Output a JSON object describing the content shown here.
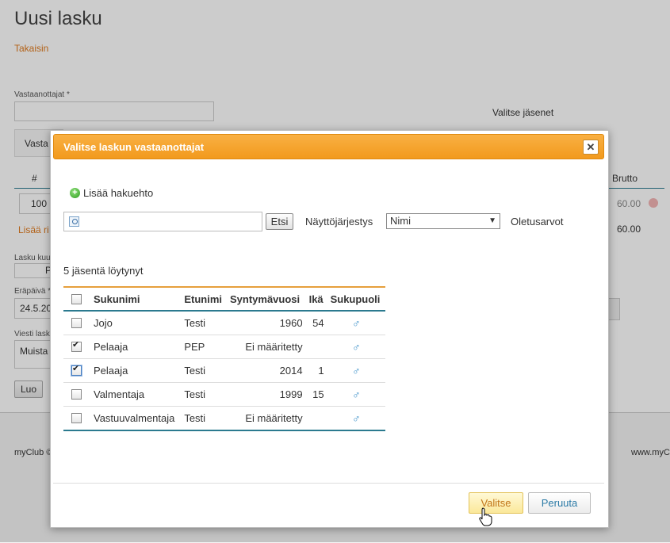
{
  "page": {
    "title": "Uusi lasku",
    "back_link": "Takaisin",
    "recipients_label": "Vastaanottajat *",
    "select_members": "Valitse jäsenet",
    "fragment_vasta": "Vasta",
    "col_hash": "#",
    "col_brutto": "Brutto",
    "qty": "100",
    "amount1": "60.00",
    "add_row": "Lisää ri",
    "amount2": "60.00",
    "invoice_label": "Lasku kuul",
    "p_letter": "P",
    "due_label": "Eräpäivä *",
    "due_value": "24.5.20",
    "message_label": "Viesti lask",
    "message_value": "Muista",
    "create_button": "Luo",
    "footer_left": "myClub ©",
    "footer_right": "www.myC"
  },
  "modal": {
    "title": "Valitse laskun vastaanottajat",
    "close": "✕",
    "add_criteria": "Lisää hakuehto",
    "search_button": "Etsi",
    "sort_label": "Näyttöjärjestys",
    "sort_value": "Nimi",
    "defaults": "Oletusarvot",
    "result_count": "5 jäsentä löytynyt",
    "columns": {
      "surname": "Sukunimi",
      "firstname": "Etunimi",
      "birthyear": "Syntymävuosi",
      "age": "Ikä",
      "gender": "Sukupuoli"
    },
    "rows": [
      {
        "surname": "Jojo",
        "firstname": "Testi",
        "birthyear": "1960",
        "age": "54",
        "checked": false
      },
      {
        "surname": "Pelaaja",
        "firstname": "PEP",
        "birthyear": "Ei määritetty",
        "age": "",
        "checked": true
      },
      {
        "surname": "Pelaaja",
        "firstname": "Testi",
        "birthyear": "2014",
        "age": "1",
        "checked": true
      },
      {
        "surname": "Valmentaja",
        "firstname": "Testi",
        "birthyear": "1999",
        "age": "15",
        "checked": false
      },
      {
        "surname": "Vastuuvalmentaja",
        "firstname": "Testi",
        "birthyear": "Ei määritetty",
        "age": "",
        "checked": false
      }
    ],
    "select_button": "Valitse",
    "cancel_button": "Peruuta"
  },
  "icons": {
    "gender": "male-icon",
    "search": "magnifier-icon",
    "add": "plus-circle-icon"
  },
  "colors": {
    "header_orange": "#f29a1d",
    "accent_teal": "#2b7a8f",
    "link_orange": "#e07b1f"
  }
}
